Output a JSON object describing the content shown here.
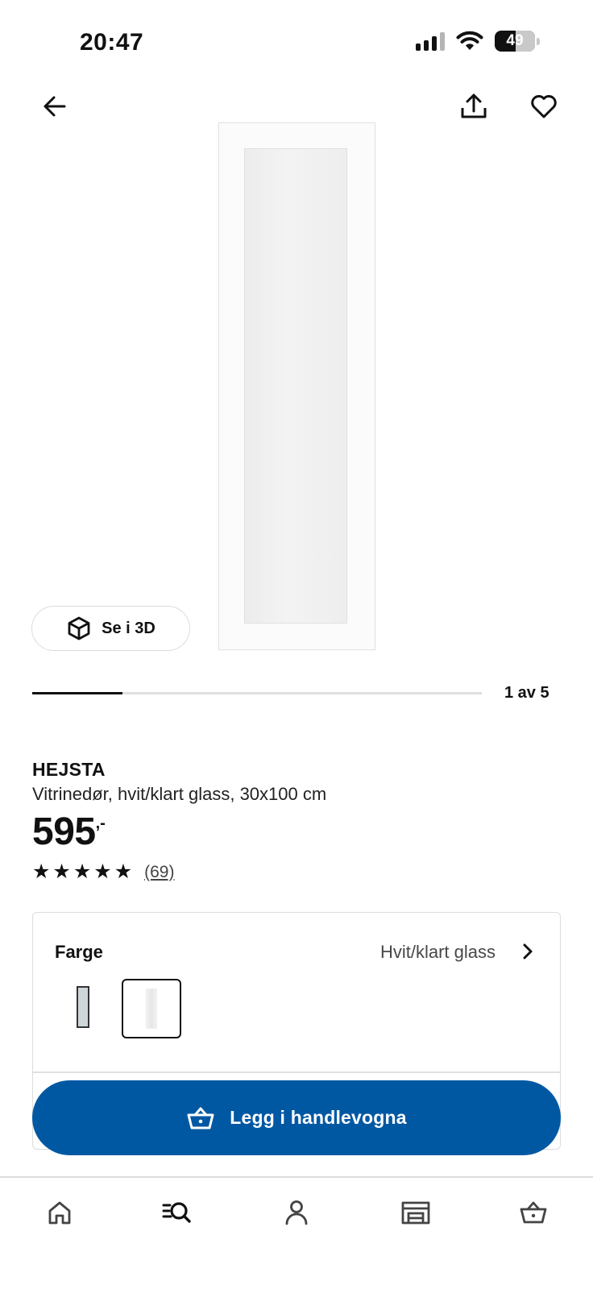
{
  "status_bar": {
    "time": "20:47",
    "battery_level": "49",
    "icons": [
      "signal-icon",
      "wifi-icon",
      "battery-icon"
    ]
  },
  "top_nav": {
    "icons": [
      "back-arrow-icon",
      "share-icon",
      "heart-icon"
    ]
  },
  "gallery": {
    "view_3d_label": "Se i 3D",
    "page_indicator": "1 av 5",
    "current_page": 1,
    "total_pages": 5
  },
  "product": {
    "name": "HEJSTA",
    "description": "Vitrinedør, hvit/klart glass, 30x100 cm",
    "price_integer": "595",
    "price_decimal": ",-",
    "rating_stars": 5,
    "review_count": "(69)"
  },
  "color_selector": {
    "label": "Farge",
    "selected_value": "Hvit/klart glass",
    "selected_index": 1
  },
  "cart": {
    "add_label": "Legg i handlevogna"
  },
  "bottom_nav": {
    "items": [
      "home-icon",
      "search-icon",
      "profile-icon",
      "store-icon",
      "cart-icon"
    ],
    "active": "search-icon"
  },
  "colors": {
    "primary_blue": "#0058a3",
    "text": "#111111"
  }
}
